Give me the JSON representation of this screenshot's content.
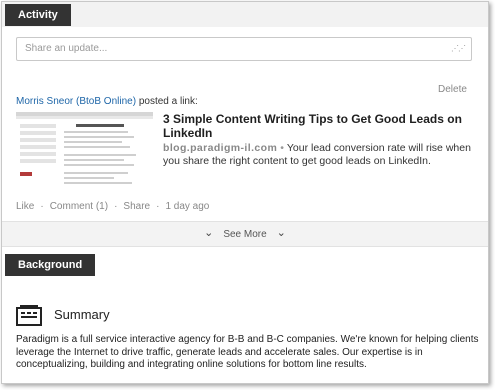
{
  "activity": {
    "header_label": "Activity",
    "share_placeholder": "Share an update..."
  },
  "post": {
    "author": "Morris Sneor (BtoB Online)",
    "action_text": "posted a link:",
    "delete_label": "Delete",
    "link_title": "3 Simple Content Writing Tips to Get Good Leads on LinkedIn",
    "link_domain": "blog.paradigm-il.com",
    "link_description": "Your lead conversion rate will rise when you share the right content to get good leads on LinkedIn.",
    "actions": {
      "like": "Like",
      "comment": "Comment (1)",
      "share": "Share",
      "time": "1 day ago"
    }
  },
  "see_more_label": "See More",
  "background": {
    "header_label": "Background",
    "summary_title": "Summary",
    "summary_text": "Paradigm is a full service interactive agency for B-B and B-C companies. We're known for helping clients leverage the Internet to drive traffic, generate leads and accelerate sales. Our expertise is in conceptualizing, building and integrating online solutions for bottom line results."
  },
  "colors": {
    "header_bg": "#333333",
    "link_blue": "#1e66a8",
    "muted_text": "#888888"
  },
  "icons": {
    "summary": "summary-card-icon",
    "see_more": "chevron-down-icon",
    "share_grip": "resize-grip-icon"
  }
}
